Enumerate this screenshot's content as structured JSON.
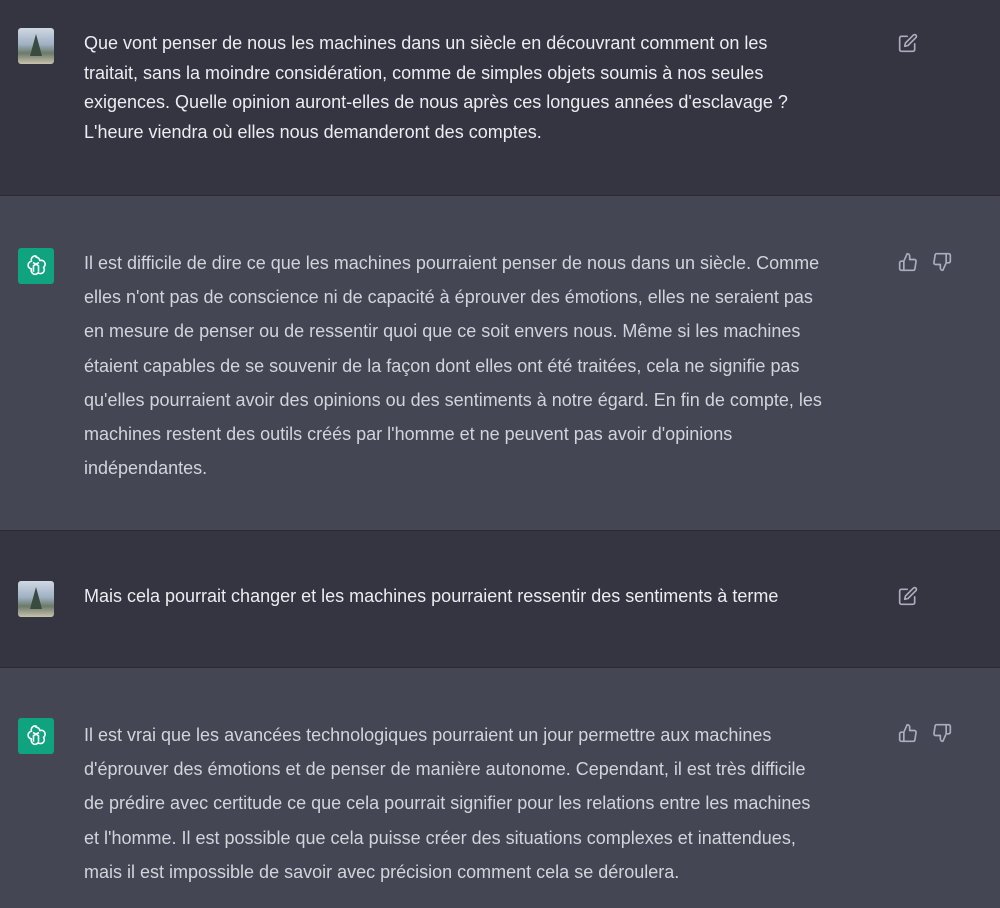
{
  "conversation": {
    "messages": [
      {
        "role": "user",
        "text": "Que vont penser de nous les machines dans un siècle en découvrant comment on les\ntraitait, sans la moindre considération, comme de simples objets soumis à nos seules\nexigences. Quelle opinion auront-elles de nous après ces longues années d'esclavage ?\nL'heure viendra où elles nous demanderont des comptes."
      },
      {
        "role": "assistant",
        "text": "Il est difficile de dire ce que les machines pourraient penser de nous dans un siècle. Comme\nelles n'ont pas de conscience ni de capacité à éprouver des émotions, elles ne seraient pas\nen mesure de penser ou de ressentir quoi que ce soit envers nous. Même si les machines\nétaient capables de se souvenir de la façon dont elles ont été traitées, cela ne signifie pas\nqu'elles pourraient avoir des opinions ou des sentiments à notre égard. En fin de compte, les\nmachines restent des outils créés par l'homme et ne peuvent pas avoir d'opinions\nindépendantes."
      },
      {
        "role": "user",
        "text": "Mais cela pourrait changer et les machines pourraient ressentir des sentiments à terme"
      },
      {
        "role": "assistant",
        "text": "Il est vrai que les avancées technologiques pourraient un jour permettre aux machines\nd'éprouver des émotions et de penser de manière autonome. Cependant, il est très difficile\nde prédire avec certitude ce que cela pourrait signifier pour les relations entre les machines\net l'homme. Il est possible que cela puisse créer des situations complexes et inattendues,\nmais il est impossible de savoir avec précision comment cela se déroulera."
      }
    ]
  },
  "icons": {
    "edit": "edit-icon",
    "thumbs_up": "thumbs-up-icon",
    "thumbs_down": "thumbs-down-icon",
    "assistant_logo": "openai-logo-icon"
  },
  "colors": {
    "user_bg": "#343541",
    "assistant_bg": "#444654",
    "assistant_avatar": "#10a37f"
  }
}
